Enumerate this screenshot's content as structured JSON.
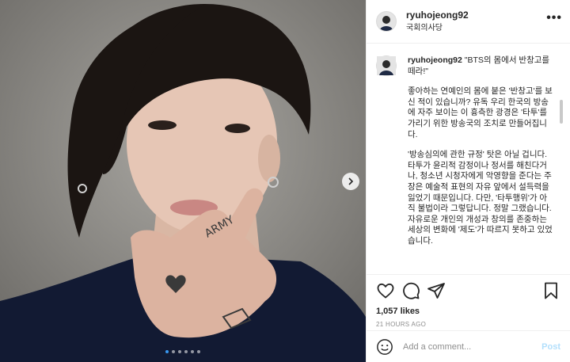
{
  "post": {
    "image_alt": "Portrait photo of a person with a tattooed hand near the face",
    "carousel": {
      "count": 6,
      "active": 0
    }
  },
  "header": {
    "username": "ryuhojeong92",
    "location": "국회의사당",
    "more_icon": "more-horizontal-icon"
  },
  "caption": {
    "username": "ryuhojeong92",
    "first": "\"BTS의 몸에서 반창고를 떼라!\"",
    "paragraphs": [
      "좋아하는 연예인의 몸에 붙은 '반창고'를 보신 적이 있습니까? 유독 우리 한국의 방송에 자주 보이는 이 흉측한 광경은 '타투'를 가리기 위한 방송국의 조치로 만들어집니다.",
      "'방송심의에 관한 규정' 탓은 아닐 겁니다. 타투가 윤리적 감정이나 정서를 해친다거나, 청소년 시청자에게 악영향을 준다는 주장은 예술적 표현의 자유 앞에서 설득력을 잃었기 때문입니다. 다만, '타투행위'가 아직 불법이라 그렇답니다. 정말 그랬습니다. 자유로운 개인의 개성과 창의를 존중하는 세상의 변화에 '제도'가 따르지 못하고 있었습니다."
    ]
  },
  "actions": {
    "icons": [
      "heart-icon",
      "comment-icon",
      "share-icon",
      "bookmark-icon"
    ],
    "likes": "1,057 likes",
    "time": "21 HOURS AGO"
  },
  "comment_box": {
    "placeholder": "Add a comment...",
    "post_label": "Post",
    "emoji_icon": "emoji-icon"
  },
  "colors": {
    "accent": "#0095f6",
    "post_disabled": "#b2dffc",
    "muted": "#8e8e8e"
  }
}
